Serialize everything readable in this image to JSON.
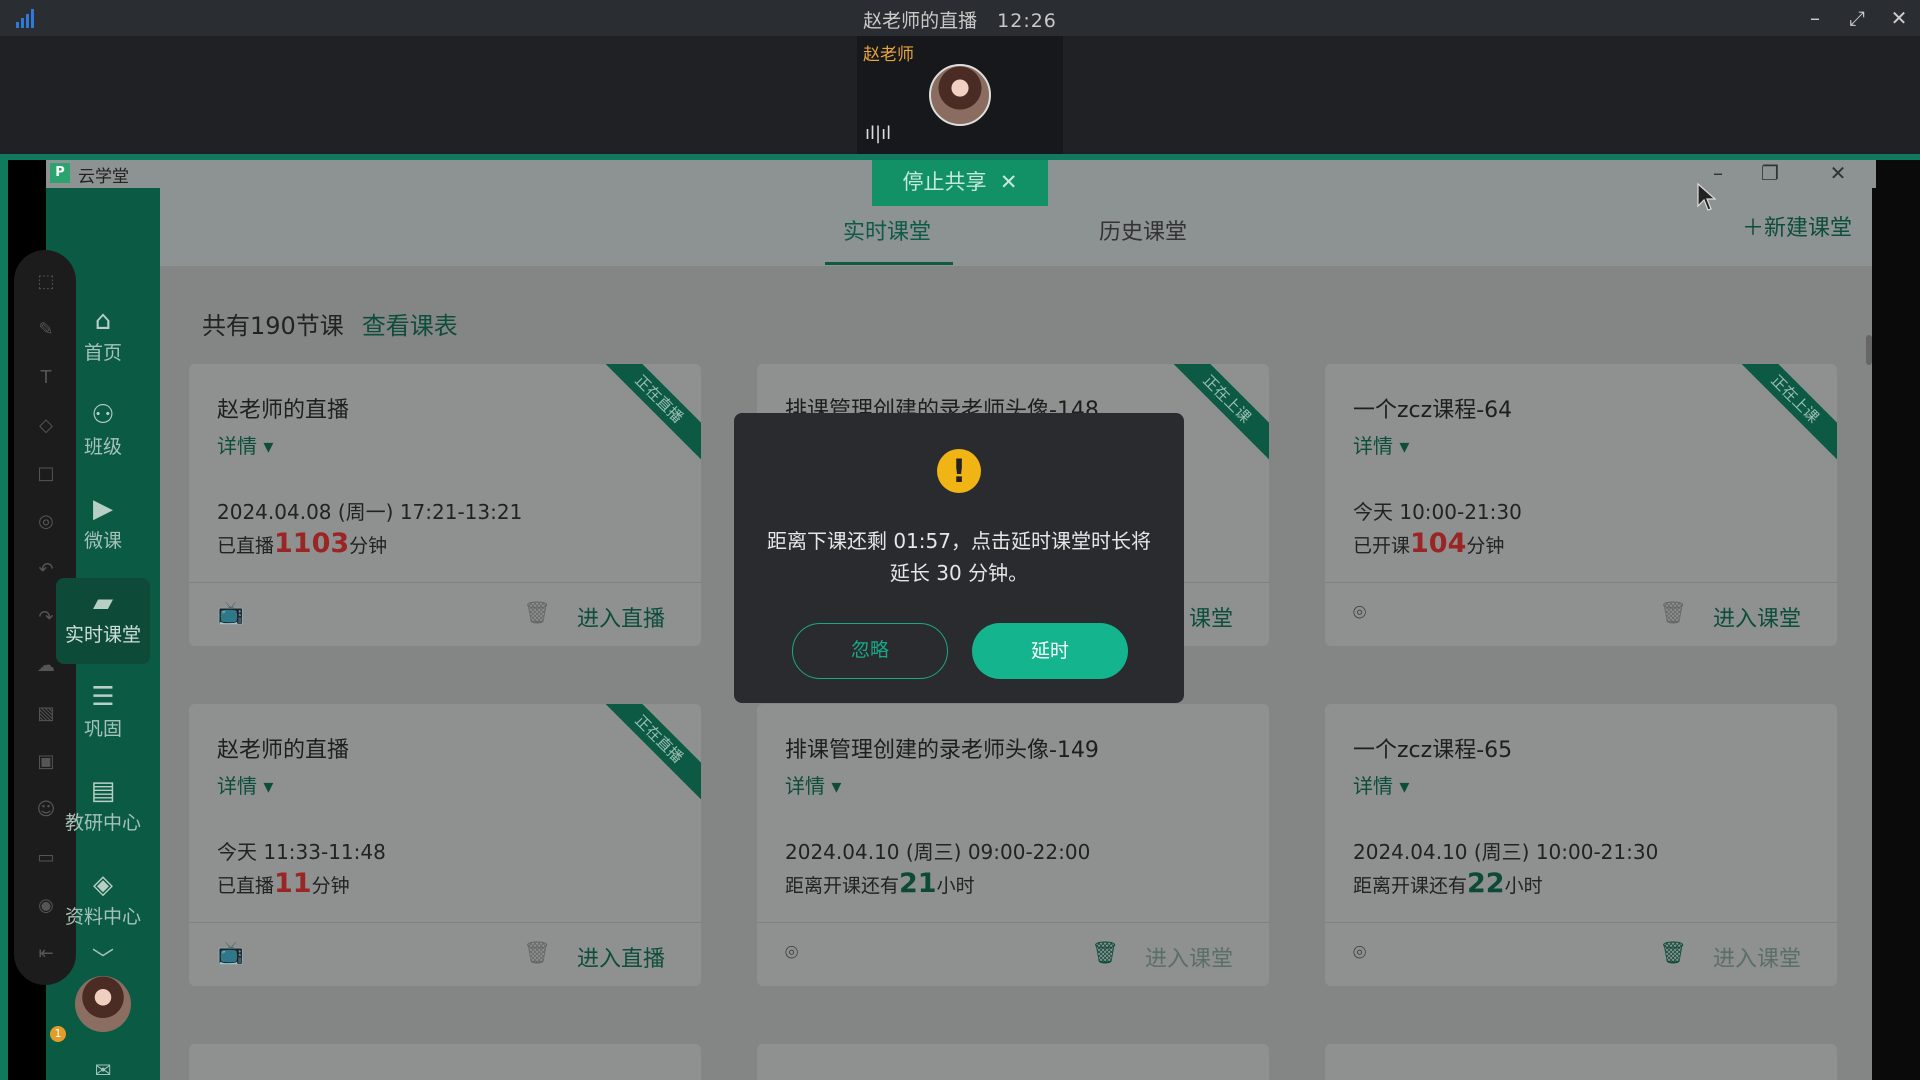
{
  "meeting": {
    "title": "赵老师的直播",
    "time": "12:26",
    "participant_name": "赵老师",
    "stop_share_label": "停止共享"
  },
  "app": {
    "name": "云学堂",
    "logo_letter": "P",
    "tabs": [
      {
        "label": "实时课堂",
        "active": true
      },
      {
        "label": "历史课堂",
        "active": false
      }
    ],
    "new_class_label": "新建课堂",
    "summary_count": "共有190节课",
    "view_schedule": "查看课表"
  },
  "sidebar": {
    "items": [
      {
        "label": "首页",
        "icon": "home-icon"
      },
      {
        "label": "班级",
        "icon": "class-icon"
      },
      {
        "label": "微课",
        "icon": "microclass-icon"
      },
      {
        "label": "实时课堂",
        "icon": "live-class-icon",
        "active": true
      },
      {
        "label": "巩固",
        "icon": "review-icon"
      },
      {
        "label": "教研中心",
        "icon": "research-icon"
      },
      {
        "label": "资料中心",
        "icon": "materials-icon"
      }
    ],
    "badge_count": "1"
  },
  "cards": [
    {
      "title": "赵老师的直播",
      "detail": "详情",
      "time": "2024.04.08 (周一) 17:21-13:21",
      "stat_prefix": "已直播",
      "stat_num": "1103",
      "stat_suffix": "分钟",
      "ribbon": "正在直播",
      "action": "进入直播"
    },
    {
      "title": "排课管理创建的录老师头像-148",
      "detail": "详情",
      "time": "",
      "stat_prefix": "",
      "stat_num": "",
      "stat_suffix": "",
      "ribbon": "正在上课",
      "action": "课堂"
    },
    {
      "title": "一个zcz课程-64",
      "detail": "详情",
      "time": "今天 10:00-21:30",
      "stat_prefix": "已开课",
      "stat_num": "104",
      "stat_suffix": "分钟",
      "ribbon": "正在上课",
      "action": "进入课堂"
    },
    {
      "title": "赵老师的直播",
      "detail": "详情",
      "time": "今天 11:33-11:48",
      "stat_prefix": "已直播",
      "stat_num": "11",
      "stat_suffix": "分钟",
      "ribbon": "正在直播",
      "action": "进入直播"
    },
    {
      "title": "排课管理创建的录老师头像-149",
      "detail": "详情",
      "time": "2024.04.10 (周三) 09:00-22:00",
      "stat_prefix": "距离开课还有",
      "stat_num": "21",
      "stat_suffix": "小时",
      "ribbon": "",
      "action": "进入课堂"
    },
    {
      "title": "一个zcz课程-65",
      "detail": "详情",
      "time": "2024.04.10 (周三) 10:00-21:30",
      "stat_prefix": "距离开课还有",
      "stat_num": "22",
      "stat_suffix": "小时",
      "ribbon": "",
      "action": "进入课堂"
    }
  ],
  "modal": {
    "message": "距离下课还剩 01:57，点击延时课堂时长将延长 30 分钟。",
    "ignore_label": "忽略",
    "extend_label": "延时"
  }
}
